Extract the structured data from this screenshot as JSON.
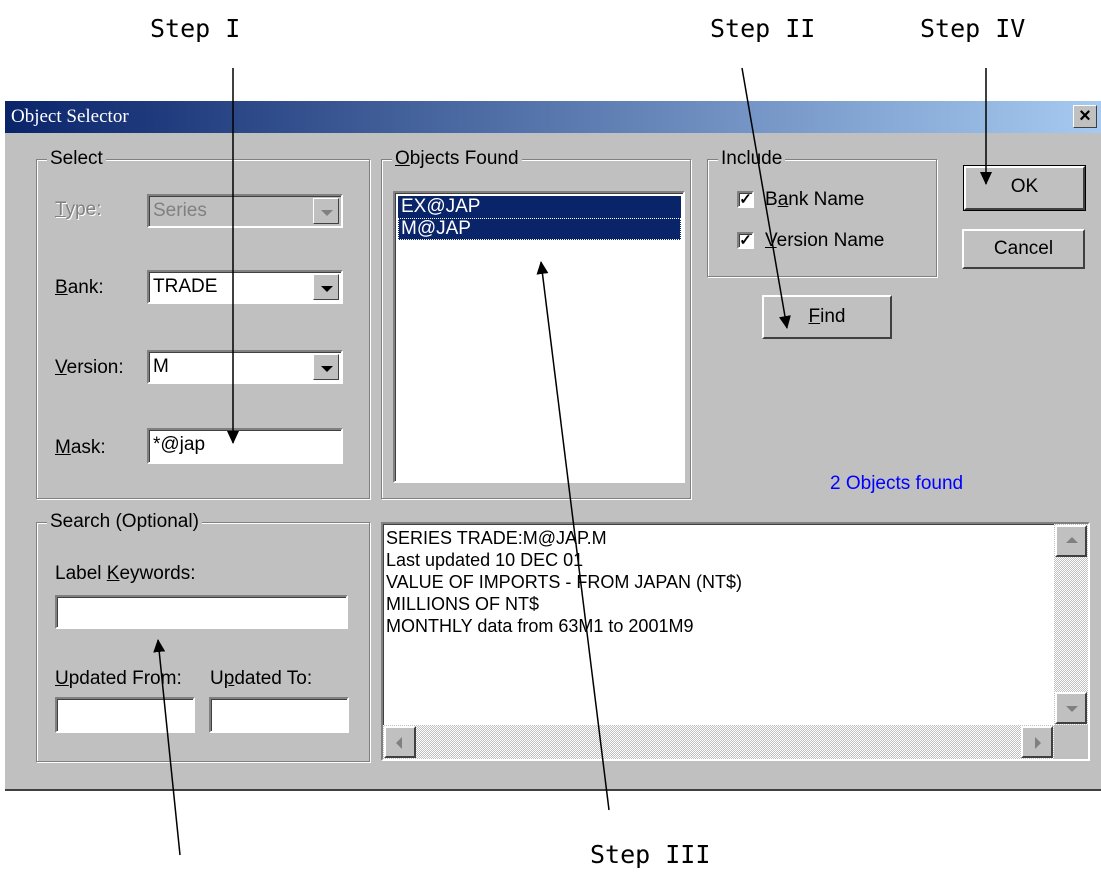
{
  "annotations": {
    "step1": "Step I",
    "step2": "Step II",
    "step3": "Step III",
    "step4": "Step IV"
  },
  "window": {
    "title": "Object Selector",
    "close_glyph": "×"
  },
  "select_group": {
    "legend": "Select",
    "type_label": "Type:",
    "type_value": "Series",
    "bank_label": "Bank:",
    "bank_value": "TRADE",
    "version_label": "Version:",
    "version_value": "M",
    "mask_label": "Mask:",
    "mask_value": "*@jap"
  },
  "objects_found": {
    "legend": "Objects Found",
    "items": [
      "EX@JAP",
      "M@JAP"
    ]
  },
  "include_group": {
    "legend": "Include",
    "bank_name": "Bank Name",
    "version_name": "Version Name",
    "bank_checked": true,
    "version_checked": true
  },
  "buttons": {
    "ok": "OK",
    "cancel": "Cancel",
    "find": "Find"
  },
  "status": "2 Objects found",
  "search_group": {
    "legend": "Search (Optional)",
    "keywords_label": "Label Keywords:",
    "keywords_value": "",
    "updated_from_label": "Updated From:",
    "updated_to_label": "Updated To:",
    "updated_from_value": "",
    "updated_to_value": ""
  },
  "info_lines": [
    "SERIES TRADE:M@JAP.M",
    "Last updated 10 DEC 01",
    "VALUE OF IMPORTS - FROM JAPAN (NT$)",
    "MILLIONS OF NT$",
    "MONTHLY data from 63M1 to 2001M9"
  ],
  "colors": {
    "titlebar_start": "#0a246a",
    "titlebar_end": "#a6caf0",
    "face": "#c0c0c0",
    "status_text": "#0000ff"
  }
}
